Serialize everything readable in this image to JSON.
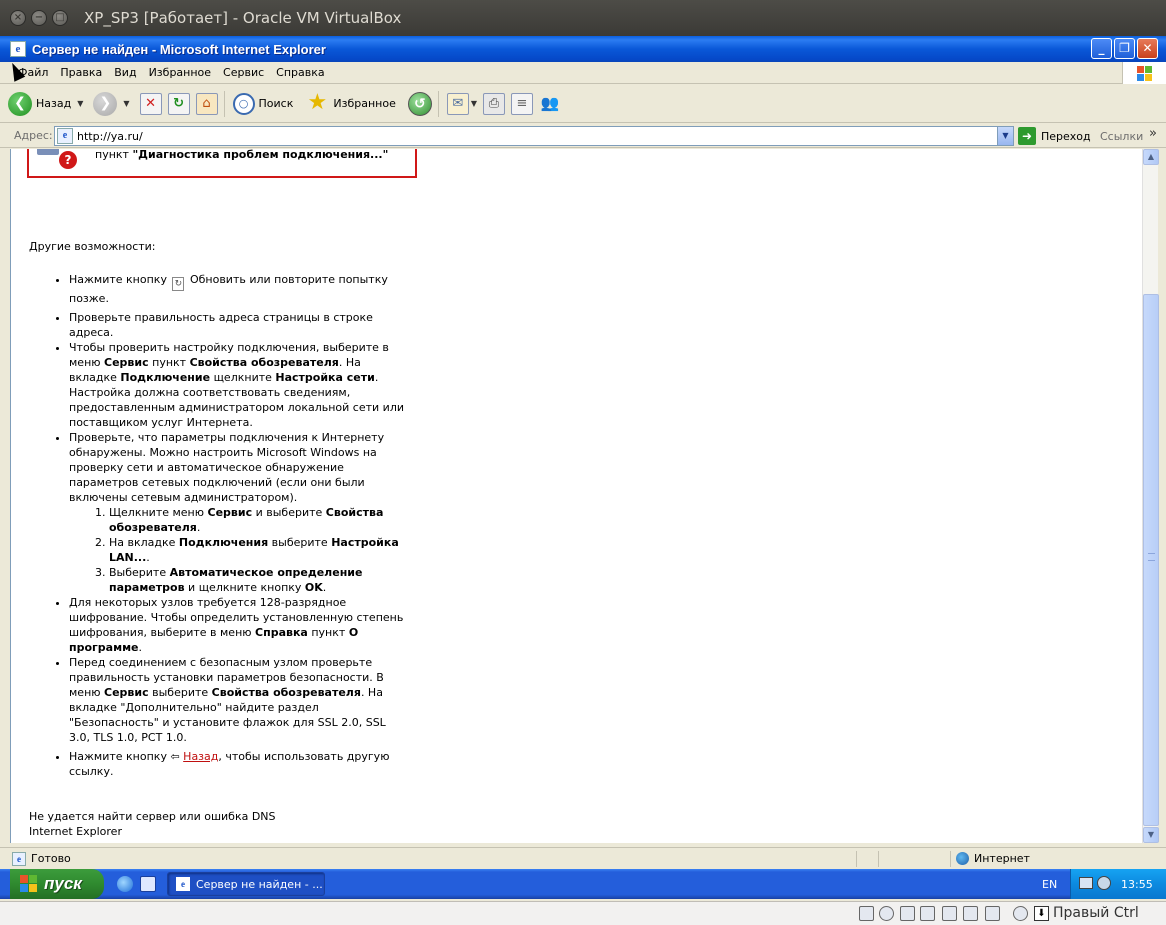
{
  "host": {
    "title": "XP_SP3 [Работает] - Oracle VM VirtualBox",
    "buttons": {
      "close": "×",
      "minimize": "−",
      "maximize": "□"
    }
  },
  "ie": {
    "title": "Сервер не найден - Microsoft Internet Explorer",
    "title_icon": "e",
    "window_buttons": {
      "minimize": "_",
      "maximize": "❐",
      "close": "✕"
    },
    "menu": [
      "Файл",
      "Правка",
      "Вид",
      "Избранное",
      "Сервис",
      "Справка"
    ],
    "toolbar": {
      "back_label": "Назад",
      "search_label": "Поиск",
      "favorites_label": "Избранное"
    },
    "address": {
      "label": "Адрес:",
      "value": "http://ya.ru/",
      "go_label": "Переход",
      "links_label": "Ссылки",
      "links_chevron": "»"
    }
  },
  "page": {
    "diag_prefix": "пункт ",
    "diag_bold": "\"Диагностика проблем подключения...\"",
    "other_title": "Другие возможности:",
    "bullets": {
      "b1_pre": "Нажмите кнопку",
      "b1_post": "Обновить или повторите попытку позже.",
      "b2": "Проверьте правильность адреса страницы в строке адреса.",
      "b3_t1": "Чтобы проверить настройку подключения, выберите в меню ",
      "b3_b1": "Сервис",
      "b3_t2": " пункт ",
      "b3_b2": "Свойства обозревателя",
      "b3_t3": ". На вкладке ",
      "b3_b3": "Подключение",
      "b3_t4": " щелкните ",
      "b3_b4": "Настройка сети",
      "b3_t5": ". Настройка должна соответствовать сведениям, предоставленным администратором локальной сети или поставщиком услуг Интернета.",
      "b4": "Проверьте, что параметры подключения к Интернету обнаружены. Можно настроить Microsoft Windows на проверку сети и автоматическое обнаружение параметров сетевых подключений (если они были включены сетевым администратором).",
      "s1_t1": "Щелкните меню ",
      "s1_b1": "Сервис",
      "s1_t2": " и выберите ",
      "s1_b2": "Свойства обозревателя",
      "s1_t3": ".",
      "s2_t1": "На вкладке ",
      "s2_b1": "Подключения",
      "s2_t2": " выберите ",
      "s2_b2": "Настройка LAN...",
      "s2_t3": ".",
      "s3_t1": "Выберите ",
      "s3_b1": "Автоматическое определение параметров",
      "s3_t2": " и щелкните кнопку ",
      "s3_b2": "OK",
      "s3_t3": ".",
      "b5_t1": "Для некоторых узлов требуется 128-разрядное шифрование. Чтобы определить установленную степень шифрования, выберите в меню ",
      "b5_b1": "Справка",
      "b5_t2": " пункт ",
      "b5_b2": "О программе",
      "b5_t3": ".",
      "b6_t1": "Перед соединением с безопасным узлом проверьте правильность установки параметров безопасности. В меню ",
      "b6_b1": "Сервис",
      "b6_t2": " выберите ",
      "b6_b2": "Свойства обозревателя",
      "b6_t3": ". На вкладке \"Дополнительно\" найдите раздел \"Безопасность\" и установите флажок для SSL 2.0, SSL 3.0, TLS 1.0, PCT 1.0.",
      "b7_pre": "Нажмите кнопку ",
      "b7_link": "Назад",
      "b7_post": ", чтобы использовать другую ссылку."
    },
    "footer_line1": "Не удается найти сервер или ошибка DNS",
    "footer_line2": "Internet Explorer"
  },
  "status": {
    "text": "Готово",
    "zone": "Интернет"
  },
  "taskbar": {
    "start_label": "пуск",
    "task_label": "Сервер не найден - ...",
    "lang": "EN",
    "clock": "13:55"
  },
  "vbox": {
    "host_key": "Правый Ctrl"
  },
  "colors": {
    "ie_title_blue": "#0a58d8",
    "start_green": "#2f8a2f",
    "taskbar_blue": "#245edb",
    "diag_border_red": "#d01818",
    "link_red": "#c01010"
  }
}
